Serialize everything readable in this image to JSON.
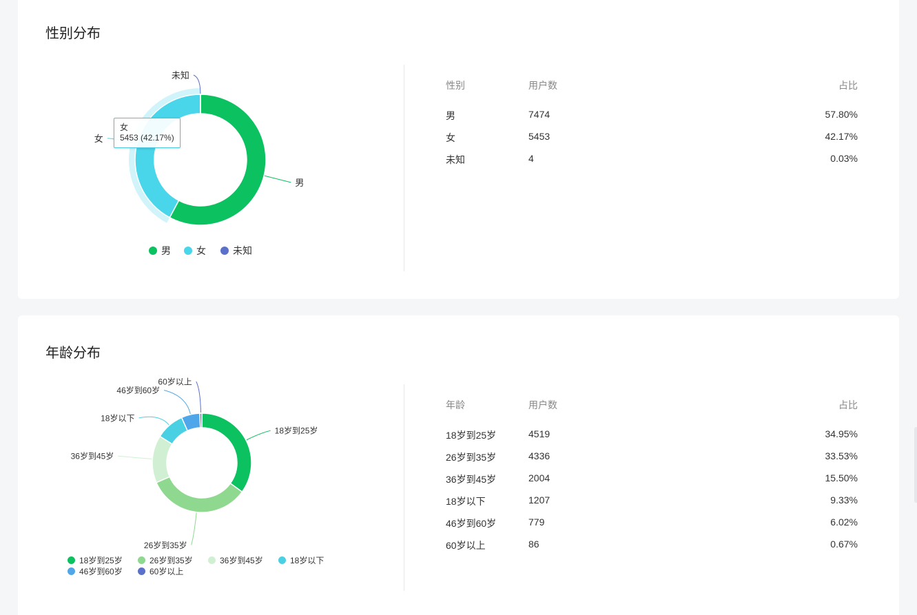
{
  "gender": {
    "title": "性别分布",
    "table": {
      "headers": [
        "性别",
        "用户数",
        "占比"
      ],
      "rows": [
        [
          "男",
          "7474",
          "57.80%"
        ],
        [
          "女",
          "5453",
          "42.17%"
        ],
        [
          "未知",
          "4",
          "0.03%"
        ]
      ]
    },
    "tooltip": {
      "name": "女",
      "value": "5453 (42.17%)"
    }
  },
  "age": {
    "title": "年龄分布",
    "table": {
      "headers": [
        "年龄",
        "用户数",
        "占比"
      ],
      "rows": [
        [
          "18岁到25岁",
          "4519",
          "34.95%"
        ],
        [
          "26岁到35岁",
          "4336",
          "33.53%"
        ],
        [
          "36岁到45岁",
          "2004",
          "15.50%"
        ],
        [
          "18岁以下",
          "1207",
          "9.33%"
        ],
        [
          "46岁到60岁",
          "779",
          "6.02%"
        ],
        [
          "60岁以上",
          "86",
          "0.67%"
        ]
      ]
    }
  },
  "chart_data": [
    {
      "type": "pie",
      "variant": "donut",
      "title": "",
      "categories": [
        "男",
        "女",
        "未知"
      ],
      "values": [
        7474,
        5453,
        4
      ],
      "colors": [
        "#0cc160",
        "#49d5ea",
        "#5b70c9"
      ],
      "legend": "bottom",
      "highlighted": "女"
    },
    {
      "type": "pie",
      "variant": "donut",
      "title": "",
      "categories": [
        "18岁到25岁",
        "26岁到35岁",
        "36岁到45岁",
        "18岁以下",
        "46岁到60岁",
        "60岁以上"
      ],
      "values": [
        4519,
        4336,
        2004,
        1207,
        779,
        86
      ],
      "colors": [
        "#0cc160",
        "#8fd88f",
        "#d1f0d3",
        "#49d0e3",
        "#4fa6e8",
        "#5b70c9"
      ],
      "legend": "bottom"
    }
  ]
}
